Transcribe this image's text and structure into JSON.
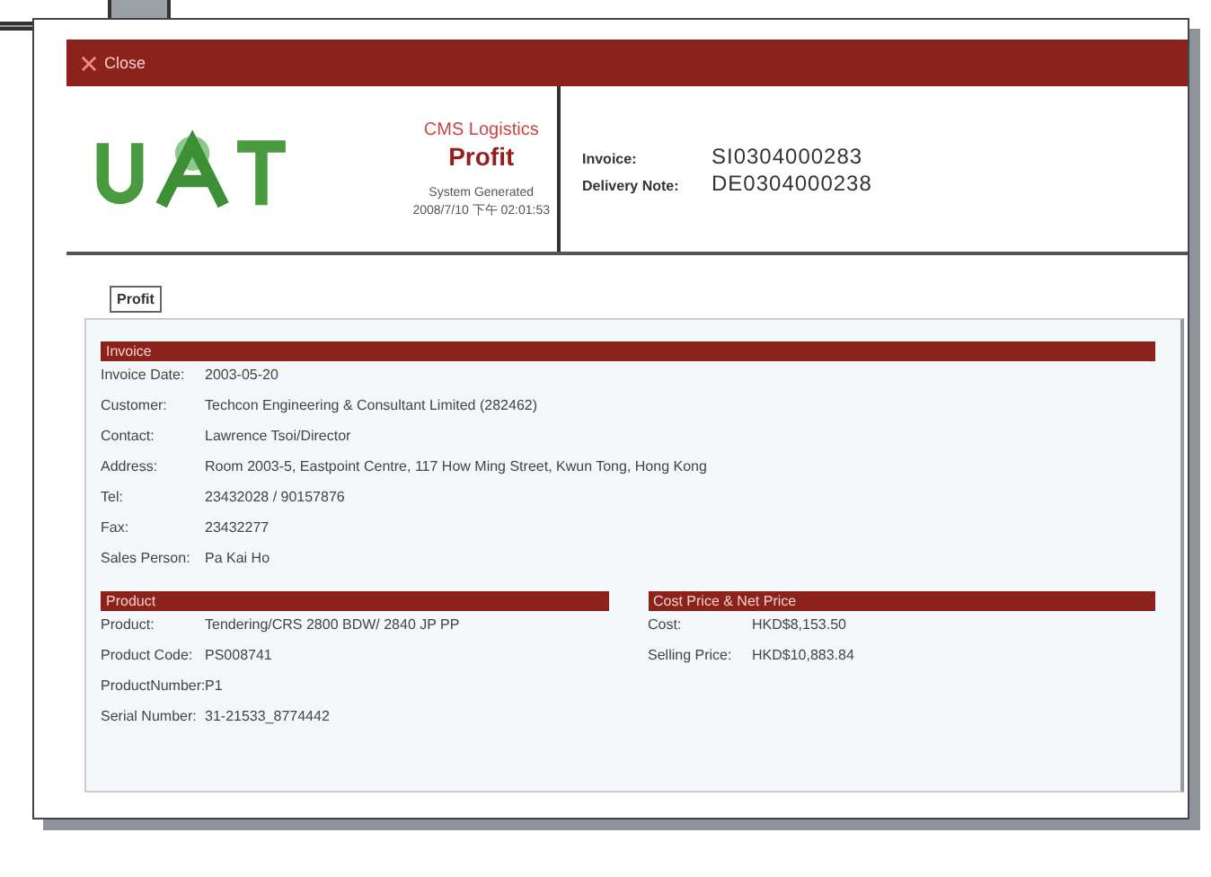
{
  "toolbar": {
    "close_label": "Close"
  },
  "header": {
    "company": "CMS Logistics",
    "title": "Profit",
    "generated_label": "System Generated",
    "generated_time": "2008/7/10 下午 02:01:53",
    "documents": [
      {
        "label": "Invoice:",
        "value": "SI0304000283"
      },
      {
        "label": "Delivery Note:",
        "value": "DE0304000238"
      }
    ]
  },
  "tabs": [
    {
      "label": "Profit",
      "selected": true
    }
  ],
  "invoice": {
    "title": "Invoice",
    "fields": [
      {
        "label": "Invoice Date:",
        "value": "2003-05-20"
      },
      {
        "label": "Customer:",
        "value": "Techcon Engineering & Consultant Limited (282462)"
      },
      {
        "label": "Contact:",
        "value": "Lawrence Tsoi/Director"
      },
      {
        "label": "Address:",
        "value": "Room 2003-5, Eastpoint Centre, 117 How Ming Street, Kwun Tong, Hong Kong"
      },
      {
        "label": "Tel:",
        "value": "23432028 / 90157876"
      },
      {
        "label": "Fax:",
        "value": "23432277"
      },
      {
        "label": "Sales Person:",
        "value": "Pa Kai Ho"
      }
    ]
  },
  "product": {
    "title": "Product",
    "fields": [
      {
        "label": "Product:",
        "value": "Tendering/CRS 2800 BDW/ 2840 JP PP"
      },
      {
        "label": "Product Code:",
        "value": "PS008741"
      },
      {
        "label": "ProductNumber:",
        "value": "P1"
      },
      {
        "label": "Serial Number:",
        "value": "31-21533_8774442"
      }
    ]
  },
  "prices": {
    "title": "Cost Price & Net Price",
    "fields": [
      {
        "label": "Cost:",
        "value": "HKD$8,153.50"
      },
      {
        "label": "Selling Price:",
        "value": "HKD$10,883.84"
      }
    ]
  }
}
